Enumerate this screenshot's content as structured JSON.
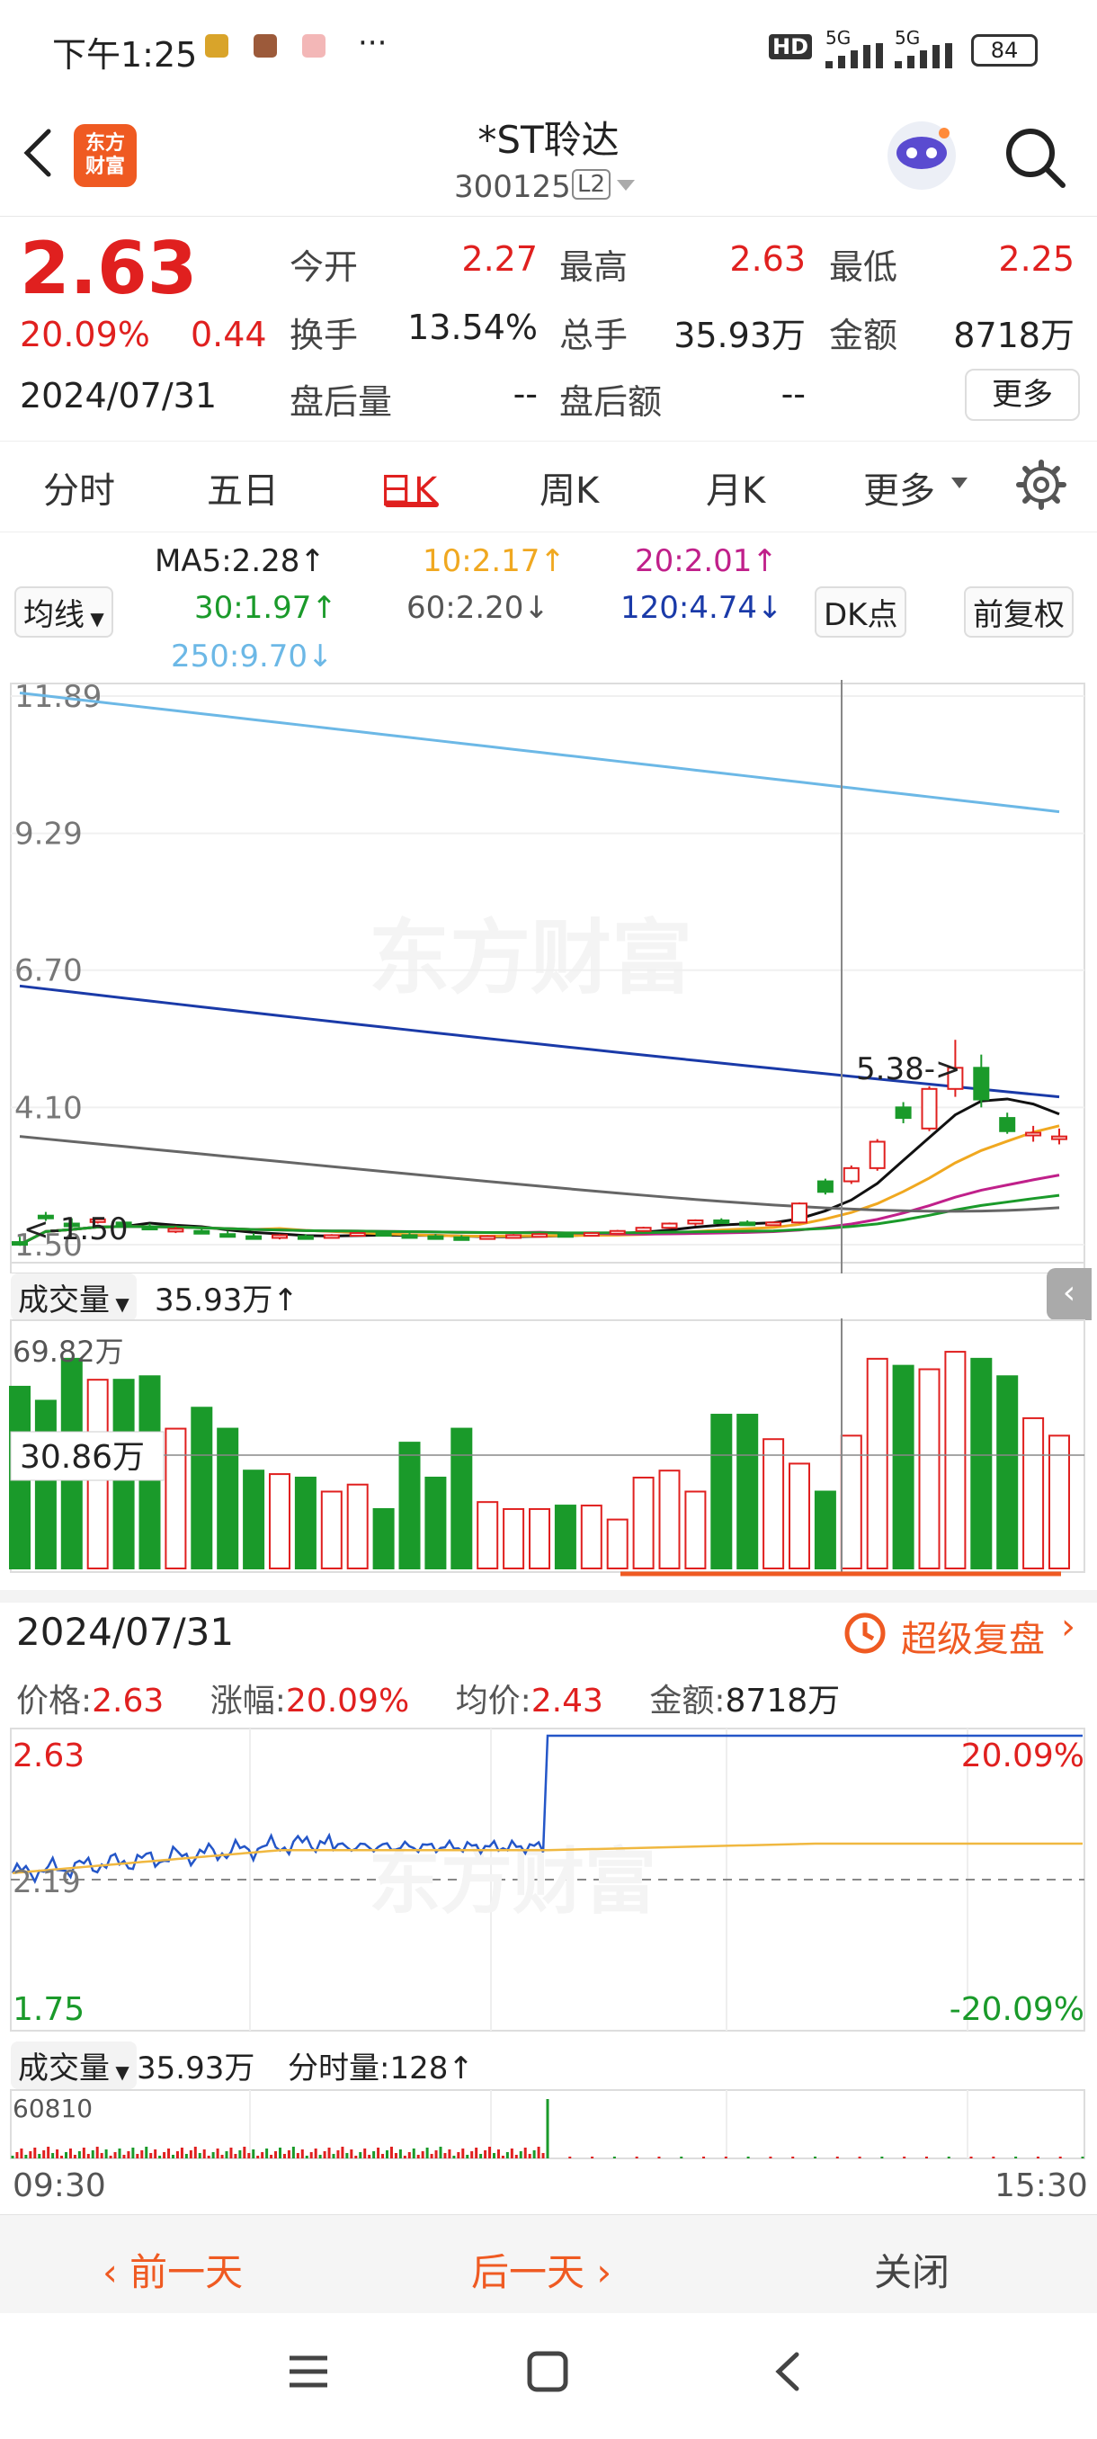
{
  "status": {
    "time": "下午1:25",
    "more": "···",
    "network_hd": "HD",
    "network_5g_a": "5G",
    "network_5g_b": "5G",
    "battery": "84"
  },
  "header": {
    "logo_line1": "东方",
    "logo_line2": "财富",
    "title": "*ST聆达",
    "code": "300125",
    "level": "L2"
  },
  "quote": {
    "price": "2.63",
    "change_pct": "20.09%",
    "change": "0.44",
    "date": "2024/07/31",
    "open_label": "今开",
    "open": "2.27",
    "high_label": "最高",
    "high": "2.63",
    "low_label": "最低",
    "low": "2.25",
    "turnover_label": "换手",
    "turnover": "13.54%",
    "volume_label": "总手",
    "volume": "35.93万",
    "amount_label": "金额",
    "amount": "8718万",
    "ah_vol_label": "盘后量",
    "ah_vol": "--",
    "ah_amt_label": "盘后额",
    "ah_amt": "--",
    "more_button": "更多"
  },
  "tabs": [
    "分时",
    "五日",
    "日K",
    "周K",
    "月K",
    "更多"
  ],
  "active_tab": "日K",
  "indicators": {
    "ma_toggle": "均线",
    "ma5": "MA5:2.28↑",
    "ma10": "10:2.17↑",
    "ma20": "20:2.01↑",
    "ma30": "30:1.97↑",
    "ma60": "60:2.20↓",
    "ma120": "120:4.74↓",
    "ma250": "250:9.70↓",
    "dk_button": "DK点",
    "adjust_button": "前复权"
  },
  "colors": {
    "up": "#e0201f",
    "down": "#1a9a2a",
    "ma5": "#111111",
    "ma10": "#f0a820",
    "ma20": "#c0208a",
    "ma30": "#1a9a2a",
    "ma60": "#666666",
    "ma120": "#1a3aa8",
    "ma250": "#6cb8e6"
  },
  "kline": {
    "y_ticks": [
      "11.89",
      "9.29",
      "6.70",
      "4.10",
      "1.50"
    ],
    "high_marker": "5.38->",
    "low_marker": "<-1.50",
    "watermark": "东方财富"
  },
  "volume": {
    "label": "成交量",
    "value": "35.93万↑",
    "max_tick": "69.82万",
    "crosshair_value": "30.86万"
  },
  "chart_data": [
    {
      "type": "candlestick",
      "title": "日K",
      "ylim": [
        1.5,
        11.89
      ],
      "candles": [
        {
          "o": 1.55,
          "h": 1.65,
          "l": 1.48,
          "c": 1.5,
          "dir": "down"
        },
        {
          "o": 2.05,
          "h": 2.12,
          "l": 1.95,
          "c": 2.0,
          "dir": "down"
        },
        {
          "o": 1.9,
          "h": 2.0,
          "l": 1.82,
          "c": 1.86,
          "dir": "down"
        },
        {
          "o": 1.94,
          "h": 2.02,
          "l": 1.9,
          "c": 1.98,
          "dir": "up"
        },
        {
          "o": 1.92,
          "h": 1.96,
          "l": 1.84,
          "c": 1.88,
          "dir": "down"
        },
        {
          "o": 1.84,
          "h": 1.9,
          "l": 1.78,
          "c": 1.82,
          "dir": "down"
        },
        {
          "o": 1.78,
          "h": 1.84,
          "l": 1.72,
          "c": 1.8,
          "dir": "up"
        },
        {
          "o": 1.76,
          "h": 1.8,
          "l": 1.7,
          "c": 1.72,
          "dir": "down"
        },
        {
          "o": 1.7,
          "h": 1.76,
          "l": 1.66,
          "c": 1.68,
          "dir": "down"
        },
        {
          "o": 1.66,
          "h": 1.72,
          "l": 1.62,
          "c": 1.64,
          "dir": "down"
        },
        {
          "o": 1.64,
          "h": 1.7,
          "l": 1.6,
          "c": 1.68,
          "dir": "up"
        },
        {
          "o": 1.66,
          "h": 1.7,
          "l": 1.62,
          "c": 1.64,
          "dir": "down"
        },
        {
          "o": 1.65,
          "h": 1.7,
          "l": 1.62,
          "c": 1.68,
          "dir": "up"
        },
        {
          "o": 1.68,
          "h": 1.74,
          "l": 1.66,
          "c": 1.72,
          "dir": "up"
        },
        {
          "o": 1.72,
          "h": 1.76,
          "l": 1.66,
          "c": 1.68,
          "dir": "down"
        },
        {
          "o": 1.68,
          "h": 1.72,
          "l": 1.64,
          "c": 1.66,
          "dir": "down"
        },
        {
          "o": 1.66,
          "h": 1.7,
          "l": 1.62,
          "c": 1.64,
          "dir": "down"
        },
        {
          "o": 1.64,
          "h": 1.68,
          "l": 1.6,
          "c": 1.62,
          "dir": "down"
        },
        {
          "o": 1.63,
          "h": 1.68,
          "l": 1.61,
          "c": 1.66,
          "dir": "up"
        },
        {
          "o": 1.66,
          "h": 1.7,
          "l": 1.63,
          "c": 1.68,
          "dir": "up"
        },
        {
          "o": 1.68,
          "h": 1.72,
          "l": 1.65,
          "c": 1.7,
          "dir": "up"
        },
        {
          "o": 1.7,
          "h": 1.74,
          "l": 1.66,
          "c": 1.68,
          "dir": "down"
        },
        {
          "o": 1.68,
          "h": 1.74,
          "l": 1.66,
          "c": 1.72,
          "dir": "up"
        },
        {
          "o": 1.72,
          "h": 1.78,
          "l": 1.7,
          "c": 1.76,
          "dir": "up"
        },
        {
          "o": 1.76,
          "h": 1.84,
          "l": 1.74,
          "c": 1.82,
          "dir": "up"
        },
        {
          "o": 1.82,
          "h": 1.92,
          "l": 1.8,
          "c": 1.9,
          "dir": "up"
        },
        {
          "o": 1.9,
          "h": 1.98,
          "l": 1.86,
          "c": 1.96,
          "dir": "up"
        },
        {
          "o": 1.96,
          "h": 2.0,
          "l": 1.9,
          "c": 1.92,
          "dir": "down"
        },
        {
          "o": 1.92,
          "h": 1.96,
          "l": 1.86,
          "c": 1.88,
          "dir": "down"
        },
        {
          "o": 1.88,
          "h": 1.94,
          "l": 1.86,
          "c": 1.92,
          "dir": "up"
        },
        {
          "o": 1.92,
          "h": 2.3,
          "l": 1.9,
          "c": 2.28,
          "dir": "up"
        },
        {
          "o": 2.5,
          "h": 2.75,
          "l": 2.45,
          "c": 2.7,
          "dir": "down"
        },
        {
          "o": 2.7,
          "h": 3.0,
          "l": 2.65,
          "c": 2.95,
          "dir": "up"
        },
        {
          "o": 2.95,
          "h": 3.5,
          "l": 2.9,
          "c": 3.45,
          "dir": "up"
        },
        {
          "o": 3.9,
          "h": 4.2,
          "l": 3.8,
          "c": 4.1,
          "dir": "down"
        },
        {
          "o": 3.7,
          "h": 4.5,
          "l": 3.65,
          "c": 4.45,
          "dir": "up"
        },
        {
          "o": 4.45,
          "h": 5.38,
          "l": 4.3,
          "c": 4.85,
          "dir": "up"
        },
        {
          "o": 4.85,
          "h": 5.1,
          "l": 4.1,
          "c": 4.25,
          "dir": "down"
        },
        {
          "o": 3.9,
          "h": 4.0,
          "l": 3.6,
          "c": 3.65,
          "dir": "down"
        },
        {
          "o": 3.6,
          "h": 3.75,
          "l": 3.45,
          "c": 3.62,
          "dir": "up"
        },
        {
          "o": 3.55,
          "h": 3.7,
          "l": 3.4,
          "c": 3.5,
          "dir": "up"
        }
      ],
      "volumes": [
        52,
        48,
        60,
        54,
        54,
        55,
        40,
        46,
        40,
        28,
        27,
        26,
        22,
        24,
        17,
        36,
        26,
        40,
        19,
        17,
        17,
        18,
        18,
        14,
        26,
        28,
        22,
        44,
        44,
        37,
        30,
        22,
        38,
        60,
        58,
        57,
        62,
        60,
        55,
        43,
        38
      ]
    },
    {
      "type": "line",
      "title": "分时",
      "ylim": [
        1.75,
        2.63
      ],
      "y_ticks_left": [
        "2.63",
        "2.19",
        "1.75"
      ],
      "y_ticks_right": [
        "20.09%",
        "-20.09%"
      ],
      "x_ticks": [
        "09:30",
        "15:30"
      ],
      "series": [
        {
          "name": "价格",
          "x": [
            "09:30",
            "10:30",
            "11:30",
            "13:00",
            "13:30",
            "14:00",
            "15:00"
          ],
          "values": [
            2.23,
            2.3,
            2.28,
            2.63,
            2.63,
            2.63,
            2.63
          ]
        },
        {
          "name": "均价",
          "x": [
            "09:30",
            "10:30",
            "11:30",
            "13:00",
            "13:30",
            "14:00",
            "15:00"
          ],
          "values": [
            2.23,
            2.26,
            2.27,
            2.28,
            2.29,
            2.3,
            2.3
          ]
        }
      ]
    }
  ],
  "detail": {
    "date": "2024/07/31",
    "review": "超级复盘",
    "price_label": "价格:",
    "price": "2.63",
    "pct_label": "涨幅:",
    "pct": "20.09%",
    "avg_label": "均价:",
    "avg": "2.43",
    "amt_label": "金额:",
    "amt": "8718万"
  },
  "intraday_volume": {
    "label": "成交量",
    "value": "35.93万",
    "tick_label": "分时量:",
    "tick_value": "128↑",
    "max": "60810"
  },
  "footer": {
    "prev": "前一天",
    "next": "后一天",
    "close": "关闭"
  }
}
